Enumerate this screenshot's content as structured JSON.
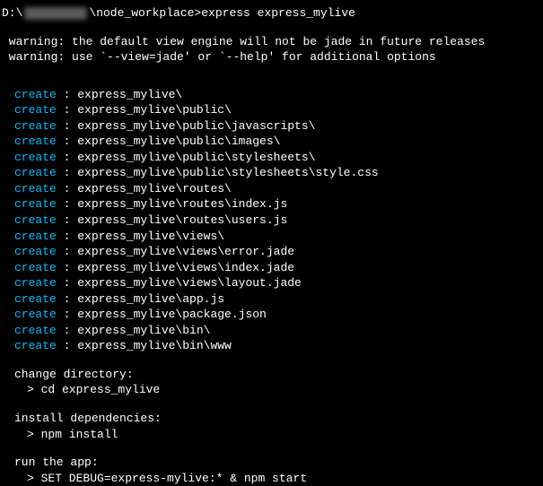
{
  "prompt": {
    "prefix": "D:\\",
    "suffix": "\\node_workplace>",
    "command": "express express_mylive"
  },
  "warnings": [
    " warning: the default view engine will not be jade in future releases",
    " warning: use `--view=jade' or `--help' for additional options"
  ],
  "create_label": "create",
  "creates": [
    "express_mylive\\",
    "express_mylive\\public\\",
    "express_mylive\\public\\javascripts\\",
    "express_mylive\\public\\images\\",
    "express_mylive\\public\\stylesheets\\",
    "express_mylive\\public\\stylesheets\\style.css",
    "express_mylive\\routes\\",
    "express_mylive\\routes\\index.js",
    "express_mylive\\routes\\users.js",
    "express_mylive\\views\\",
    "express_mylive\\views\\error.jade",
    "express_mylive\\views\\index.jade",
    "express_mylive\\views\\layout.jade",
    "express_mylive\\app.js",
    "express_mylive\\package.json",
    "express_mylive\\bin\\",
    "express_mylive\\bin\\www"
  ],
  "instructions": [
    {
      "title": "change directory:",
      "cmd": "> cd express_mylive"
    },
    {
      "title": "install dependencies:",
      "cmd": "> npm install"
    },
    {
      "title": "run the app:",
      "cmd": "> SET DEBUG=express-mylive:* & npm start"
    }
  ]
}
